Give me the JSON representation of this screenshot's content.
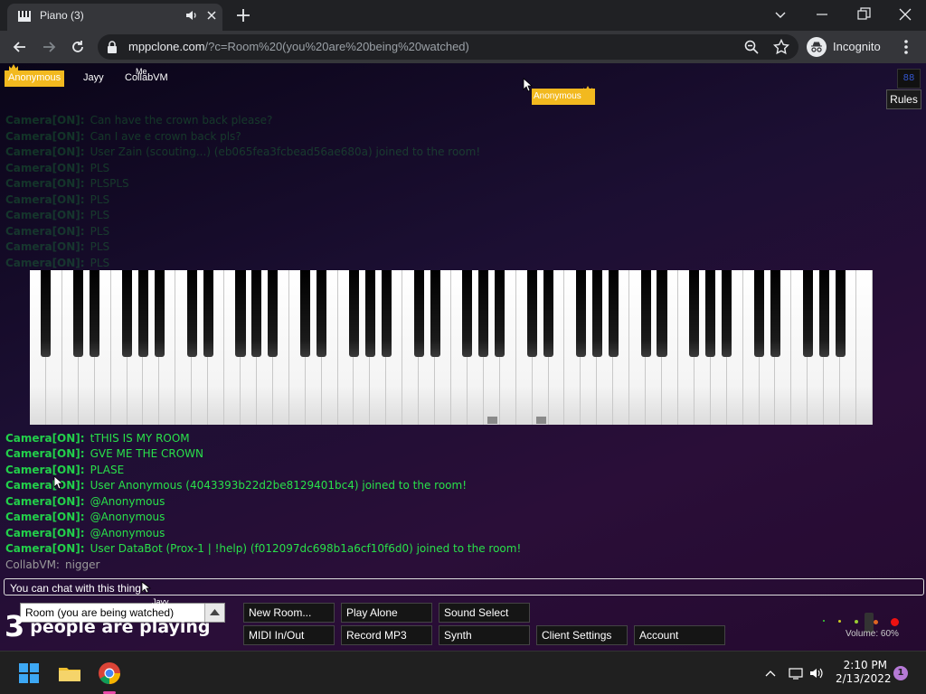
{
  "browser": {
    "tab_title": "Piano (3)",
    "url_domain": "mppclone.com",
    "url_path": "/?c=Room%20(you%20are%20being%20watched)",
    "incognito_label": "Incognito"
  },
  "page": {
    "participants": {
      "anonymous": "Anonymous",
      "jayy": "Jayy",
      "collab": "CollabVM",
      "me_label": "Me"
    },
    "cursor_tag": "Anonymous",
    "rules_label": "Rules",
    "top_right_icon_label": "88",
    "chat": [
      {
        "name": "Camera[ON]:",
        "msg": "Can have the crown back please?",
        "faded": true
      },
      {
        "name": "Camera[ON]:",
        "msg": "Can I ave e crown back pls?",
        "faded": true
      },
      {
        "name": "Camera[ON]:",
        "msg": "User Zain (scouting...) (eb065fea3fcbead56ae680a) joined to the room!",
        "faded": true
      },
      {
        "name": "Camera[ON]:",
        "msg": "PLS",
        "faded": true
      },
      {
        "name": "Camera[ON]:",
        "msg": "PLSPLS",
        "faded": true
      },
      {
        "name": "Camera[ON]:",
        "msg": "PLS",
        "faded": true
      },
      {
        "name": "Camera[ON]:",
        "msg": "PLS",
        "faded": true
      },
      {
        "name": "Camera[ON]:",
        "msg": "PLS",
        "faded": true
      },
      {
        "name": "Camera[ON]:",
        "msg": "PLS",
        "faded": true
      },
      {
        "name": "Camera[ON]:",
        "msg": "PLS",
        "faded": true
      },
      {
        "name": "Camera[ON]:",
        "msg": "tTHIS IS MY ROOM",
        "faded": false
      },
      {
        "name": "Camera[ON]:",
        "msg": "GVE ME THE CROWN",
        "faded": false
      },
      {
        "name": "Camera[ON]:",
        "msg": "PLASE",
        "faded": false
      },
      {
        "name": "Camera[ON]:",
        "msg": "User Anonymous (4043393b22d2be8129401bc4) joined to the room!",
        "faded": false
      },
      {
        "name": "Camera[ON]:",
        "msg": "@Anonymous",
        "faded": false
      },
      {
        "name": "Camera[ON]:",
        "msg": "@Anonymous",
        "faded": false
      },
      {
        "name": "Camera[ON]:",
        "msg": "@Anonymous",
        "faded": false
      },
      {
        "name": "Camera[ON]:",
        "msg": "User DataBot (Prox-1 | !help) (f012097dc698b1a6cf10f6d0) joined to the room!",
        "faded": false
      },
      {
        "name": "CollabVM:",
        "msg": "nigger",
        "faded": false,
        "grey": true
      }
    ],
    "chat_input_value": "You can chat with this thing.",
    "room_select_value": "Room (you are being watched)",
    "room_cursor_label": "Jayy",
    "players_count": "3",
    "players_text": "people are playing",
    "buttons": {
      "new_room": "New Room...",
      "play_alone": "Play Alone",
      "sound_select": "Sound Select",
      "midi": "MIDI In/Out",
      "record": "Record MP3",
      "synth": "Synth",
      "client_settings": "Client Settings",
      "account": "Account"
    },
    "volume_label": "Volume: 60%"
  },
  "taskbar": {
    "time": "2:10 PM",
    "date": "2/13/2022",
    "notifications": "1"
  },
  "colors": {
    "crown": "#f2b91f",
    "chat_name": "#22d04a",
    "background": "#1c0f33"
  }
}
